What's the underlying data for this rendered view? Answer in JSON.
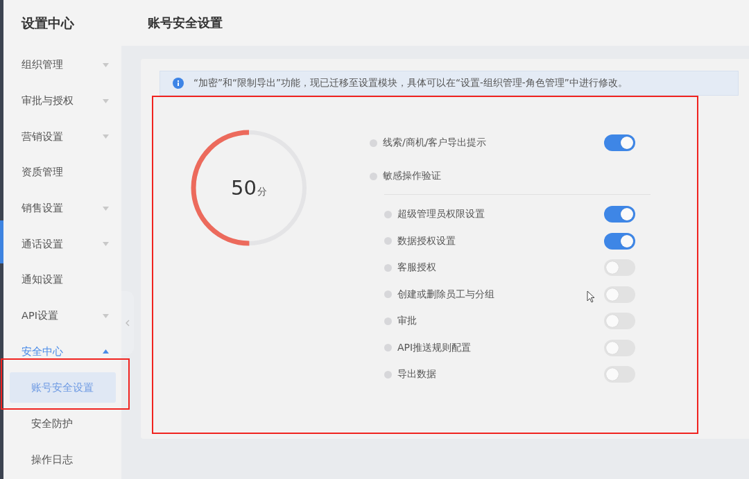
{
  "sidebar": {
    "title": "设置中心",
    "items": [
      {
        "label": "组织管理",
        "kind": "group",
        "expanded": false
      },
      {
        "label": "审批与授权",
        "kind": "group",
        "expanded": false
      },
      {
        "label": "营销设置",
        "kind": "group",
        "expanded": false
      },
      {
        "label": "资质管理",
        "kind": "link"
      },
      {
        "label": "销售设置",
        "kind": "group",
        "expanded": false
      },
      {
        "label": "通话设置",
        "kind": "group",
        "expanded": false
      },
      {
        "label": "通知设置",
        "kind": "link"
      },
      {
        "label": "API设置",
        "kind": "group",
        "expanded": false
      },
      {
        "label": "安全中心",
        "kind": "group",
        "expanded": true,
        "children": [
          {
            "label": "账号安全设置",
            "selected": true
          },
          {
            "label": "安全防护",
            "selected": false
          },
          {
            "label": "操作日志",
            "selected": false
          }
        ]
      }
    ]
  },
  "header": {
    "title": "账号安全设置"
  },
  "notice": {
    "text": "“加密”和“限制导出”功能，现已迁移至设置模块，具体可以在“设置-组织管理-角色管理”中进行修改。"
  },
  "score": {
    "value": "50",
    "unit": "分",
    "level": 0.5
  },
  "settings": [
    {
      "kind": "toggle",
      "label": "线索/商机/客户导出提示",
      "on": true
    },
    {
      "kind": "section",
      "label": "敏感操作验证",
      "children": [
        {
          "label": "超级管理员权限设置",
          "on": true
        },
        {
          "label": "数据授权设置",
          "on": true
        },
        {
          "label": "客服授权",
          "on": false
        },
        {
          "label": "创建或删除员工与分组",
          "on": false
        },
        {
          "label": "审批",
          "on": false
        },
        {
          "label": "API推送规则配置",
          "on": false
        },
        {
          "label": "导出数据",
          "on": false
        }
      ]
    }
  ]
}
